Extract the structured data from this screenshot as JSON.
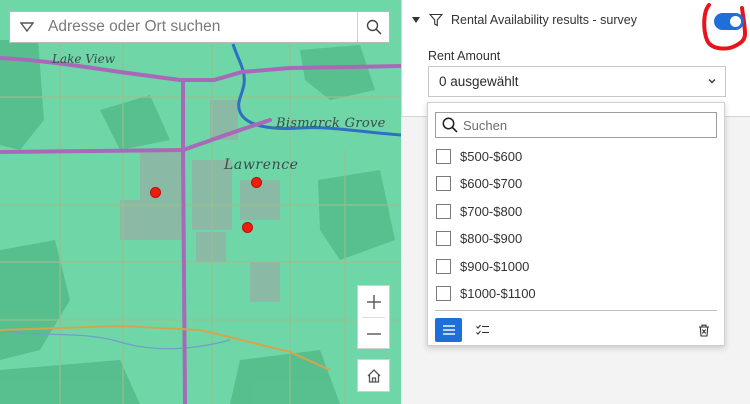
{
  "search": {
    "placeholder": "Adresse oder Ort suchen",
    "icon": "search-icon"
  },
  "map": {
    "labels": {
      "lake_view": "Lake View",
      "bismarck_grove": "Bismarck Grove",
      "lawrence": "Lawrence"
    },
    "pin_color": "#f01d0f",
    "base_color": "#6fd6a8",
    "road_color": "#a869b8",
    "river_color": "#2f6fc4"
  },
  "zoom": {
    "in": "+",
    "out": "−"
  },
  "layer": {
    "title": "Rental Availability results - survey",
    "toggle_on": true,
    "accent": "#1e6fd9"
  },
  "filter": {
    "field_label": "Rent Amount",
    "selected_value": "0 ausgewählt",
    "search_placeholder": "Suchen",
    "options": [
      {
        "label": "$500-$600",
        "checked": false
      },
      {
        "label": "$600-$700",
        "checked": false
      },
      {
        "label": "$700-$800",
        "checked": false
      },
      {
        "label": "$800-$900",
        "checked": false
      },
      {
        "label": "$900-$1000",
        "checked": false
      },
      {
        "label": "$1000-$1100",
        "checked": false
      }
    ]
  }
}
